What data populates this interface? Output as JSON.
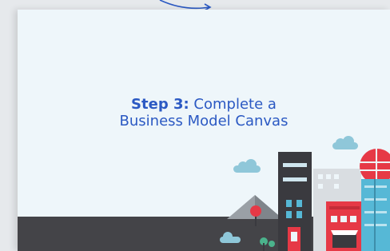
{
  "card": {
    "step_label": "Step 3:",
    "title_line1": " Complete a",
    "title_line2": "Business Model Canvas"
  },
  "colors": {
    "accent": "#2b59c3",
    "card_background": "#eef6fa",
    "ground": "#444448",
    "building_red": "#e63946",
    "building_dark": "#3a3a3f",
    "building_teal": "#56b8d6",
    "cloud": "#8fc7d9"
  },
  "icons": [
    "curved-arrow-icon",
    "city-skyline-illustration"
  ]
}
